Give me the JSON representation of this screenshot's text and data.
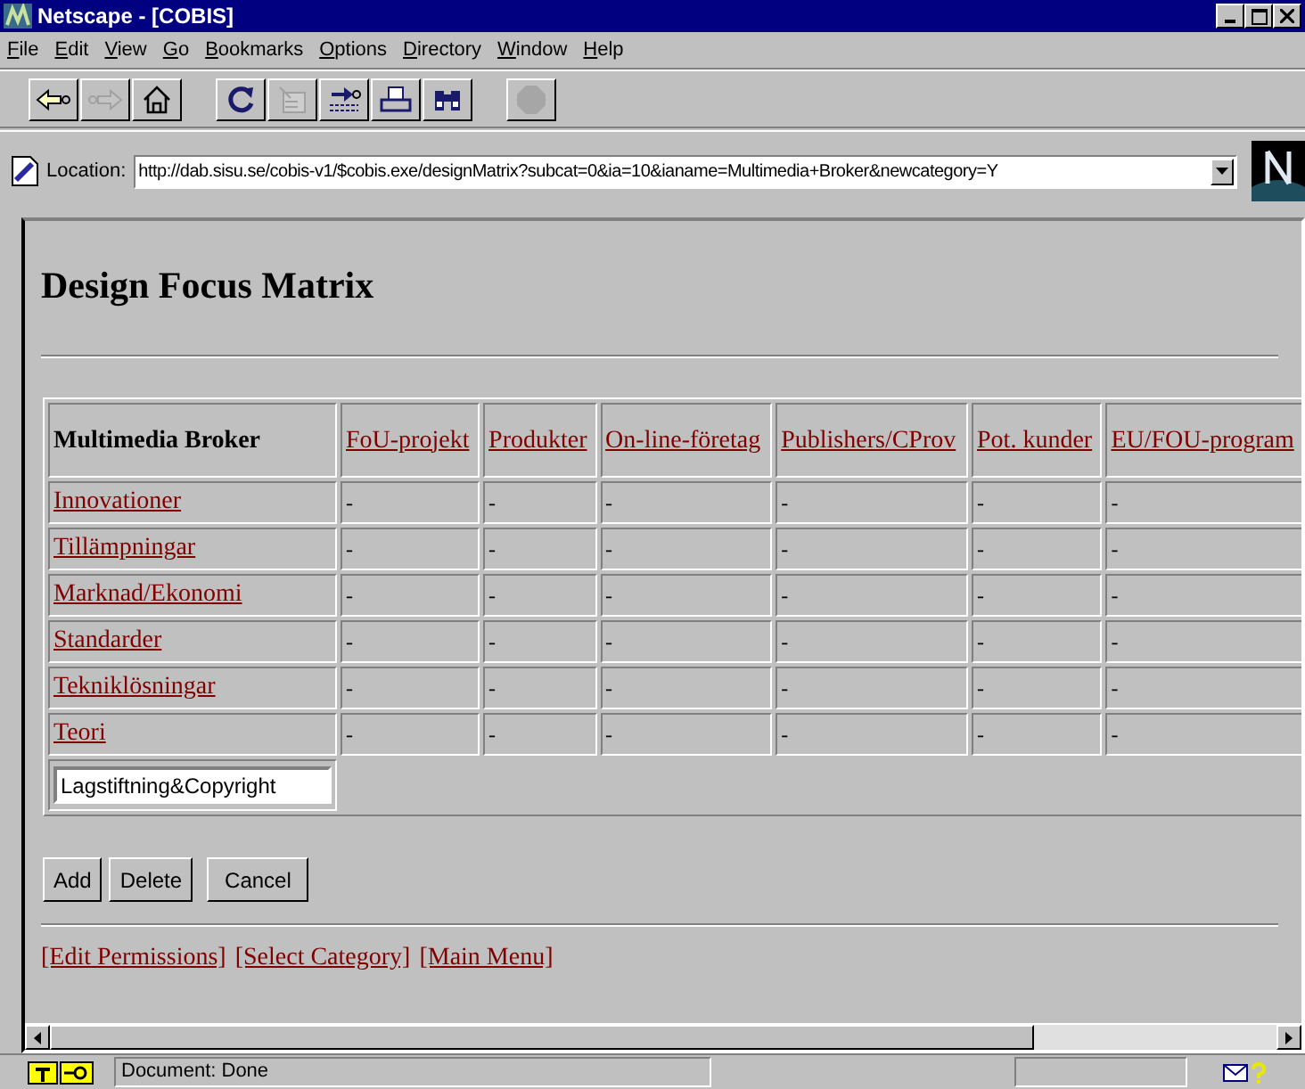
{
  "window": {
    "title": "Netscape - [COBIS]"
  },
  "menu": [
    "File",
    "Edit",
    "View",
    "Go",
    "Bookmarks",
    "Options",
    "Directory",
    "Window",
    "Help"
  ],
  "toolbar": [
    {
      "kind": "back",
      "disabled": false
    },
    {
      "kind": "forward",
      "disabled": true
    },
    {
      "kind": "home",
      "disabled": false
    },
    {
      "kind": "reload",
      "disabled": false
    },
    {
      "kind": "images",
      "disabled": true
    },
    {
      "kind": "open",
      "disabled": false
    },
    {
      "kind": "print",
      "disabled": false
    },
    {
      "kind": "find",
      "disabled": false
    },
    {
      "kind": "stop",
      "disabled": true
    }
  ],
  "location": {
    "label": "Location:",
    "value": "http://dab.sisu.se/cobis-v1/$cobis.exe/designMatrix?subcat=0&ia=10&ianame=Multimedia+Broker&newcategory=Y"
  },
  "page": {
    "heading": "Design Focus Matrix",
    "table": {
      "corner": "Multimedia Broker",
      "columns": [
        "FoU-projekt",
        "Produkter",
        "On-line-företag",
        "Publishers/CProv",
        "Pot. kunder",
        "EU/FOU-program"
      ],
      "rows": [
        {
          "label": "Innovationer",
          "cells": [
            "-",
            "-",
            "-",
            "-",
            "-",
            "-"
          ]
        },
        {
          "label": "Tillämpningar",
          "cells": [
            "-",
            "-",
            "-",
            "-",
            "-",
            "-"
          ]
        },
        {
          "label": "Marknad/Ekonomi",
          "cells": [
            "-",
            "-",
            "-",
            "-",
            "-",
            "-"
          ]
        },
        {
          "label": "Standarder",
          "cells": [
            "-",
            "-",
            "-",
            "-",
            "-",
            "-"
          ]
        },
        {
          "label": "Tekniklösningar",
          "cells": [
            "-",
            "-",
            "-",
            "-",
            "-",
            "-"
          ]
        },
        {
          "label": "Teori",
          "cells": [
            "-",
            "-",
            "-",
            "-",
            "-",
            "-"
          ]
        }
      ],
      "new_category": {
        "value": "Lagstiftning&Copyright"
      }
    },
    "buttons": [
      "Add",
      "Delete",
      "Cancel"
    ],
    "links": [
      "[Edit Permissions]",
      "[Select Category]",
      "[Main Menu]"
    ]
  },
  "status_bar": {
    "text": "Document: Done"
  }
}
